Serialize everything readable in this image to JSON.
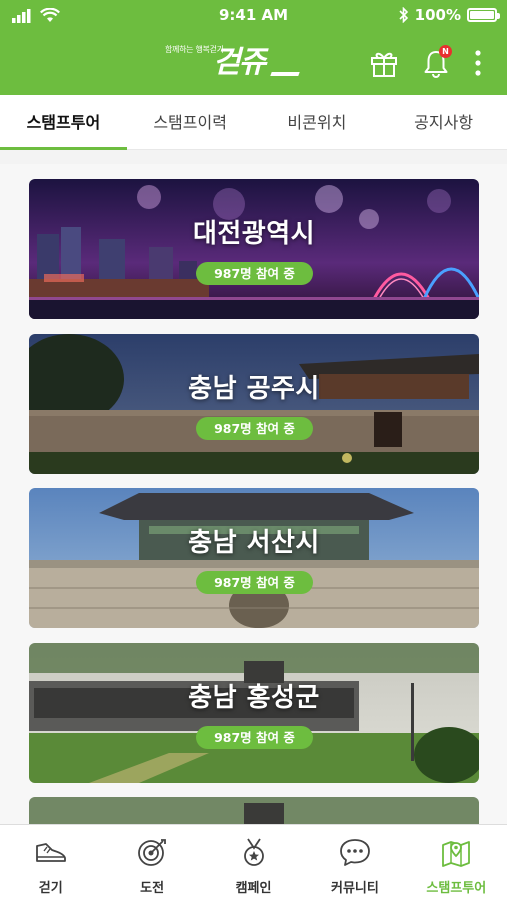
{
  "status_bar": {
    "time": "9:41 AM",
    "battery": "100%",
    "icons": [
      "signal-icon",
      "wifi-icon",
      "bluetooth-icon",
      "battery-icon"
    ]
  },
  "app_bar": {
    "logo_subtitle": "함께하는 행복걷기",
    "logo_text": "걷쥬",
    "notification_badge": "N",
    "icons": [
      "gift-icon",
      "bell-icon",
      "more-icon"
    ]
  },
  "tabs": [
    {
      "label": "스탬프투어",
      "active": true
    },
    {
      "label": "스탬프이력",
      "active": false
    },
    {
      "label": "비콘위치",
      "active": false
    },
    {
      "label": "공지사항",
      "active": false
    }
  ],
  "tours": [
    {
      "name": "대전광역시",
      "participants": "987명 참여 중"
    },
    {
      "name": "충남 공주시",
      "participants": "987명 참여 중"
    },
    {
      "name": "충남 서산시",
      "participants": "987명 참여 중"
    },
    {
      "name": "충남 홍성군",
      "participants": "987명 참여 중"
    }
  ],
  "bottom_nav": [
    {
      "label": "걷기",
      "icon": "shoe-icon",
      "active": false
    },
    {
      "label": "도전",
      "icon": "target-icon",
      "active": false
    },
    {
      "label": "캠페인",
      "icon": "medal-icon",
      "active": false
    },
    {
      "label": "커뮤니티",
      "icon": "chat-icon",
      "active": false
    },
    {
      "label": "스탬프투어",
      "icon": "map-pin-icon",
      "active": true
    }
  ],
  "colors": {
    "brand_green": "#6dbd3f",
    "badge_red": "#e8302f"
  }
}
